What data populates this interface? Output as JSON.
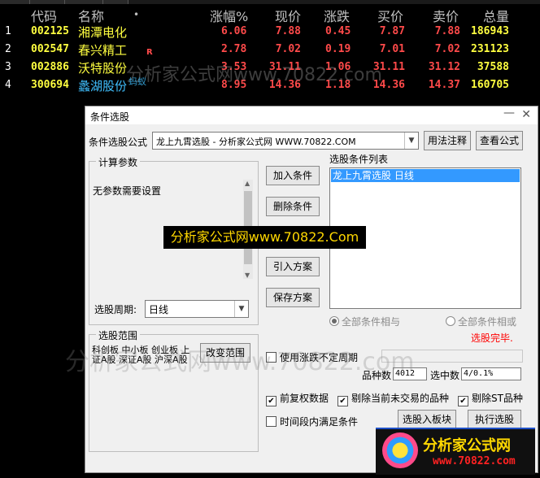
{
  "table": {
    "headers": {
      "code": "代码",
      "name": "名称",
      "dot": "•",
      "change_pct": "涨幅%",
      "price": "现价",
      "change": "涨跌",
      "bid": "买价",
      "ask": "卖价",
      "volume": "总量"
    },
    "rows": [
      {
        "idx": "1",
        "code": "002125",
        "name": "湘潭电化",
        "mark": "",
        "change_pct": "6.06",
        "price": "7.88",
        "change": "0.45",
        "bid": "7.87",
        "ask": "7.88",
        "volume": "186943"
      },
      {
        "idx": "2",
        "code": "002547",
        "name": "春兴精工",
        "mark": "R",
        "change_pct": "2.78",
        "price": "7.02",
        "change": "0.19",
        "bid": "7.01",
        "ask": "7.02",
        "volume": "231123"
      },
      {
        "idx": "3",
        "code": "002886",
        "name": "沃特股份",
        "mark": "",
        "change_pct": "3.53",
        "price": "31.11",
        "change": "1.06",
        "bid": "31.11",
        "ask": "31.12",
        "volume": "37588"
      },
      {
        "idx": "4",
        "code": "300694",
        "name": "蠡湖股份",
        "mark": "",
        "change_pct": "8.95",
        "price": "14.36",
        "change": "1.18",
        "bid": "14.36",
        "ask": "14.37",
        "volume": "160705"
      }
    ]
  },
  "watermarks": {
    "w1": "分析家公式网www.70822.com",
    "w2": "蚂蚁",
    "w3": "分析家公式网www.70822.com"
  },
  "dialog": {
    "title": "条件选股",
    "formula_label": "条件选股公式",
    "formula_value": "龙上九霄选股 - 分析家公式网 WWW.70822.COM",
    "btn_usage": "用法注释",
    "btn_view": "查看公式",
    "params_group": "计算参数",
    "params_text": "无参数需要设置",
    "btn_add": "加入条件",
    "btn_delete": "删除条件",
    "btn_import": "引入方案",
    "btn_save": "保存方案",
    "list_label": "选股条件列表",
    "list_items": [
      "龙上九霄选股  日线"
    ],
    "period_label": "选股周期:",
    "period_value": "日线",
    "radio_and": "全部条件相与",
    "radio_or": "全部条件相或",
    "status": "选股完毕.",
    "range_group": "选股范围",
    "range_text": "科创板 中小板 创业板 上证A股 深证A股 沪深A股",
    "btn_change_range": "改变范围",
    "chk_uncertain": "使用涨跌不定周期",
    "count_label": "品种数",
    "count_value": "4012",
    "selected_label": "选中数",
    "selected_value": "4/0.1%",
    "chk_prefq": "前复权数据",
    "chk_exclude_nontrade": "剔除当前未交易的品种",
    "chk_exclude_st": "剔除ST品种",
    "chk_time_range": "时间段内满足条件",
    "btn_to_block": "选股入板块",
    "btn_execute": "执行选股"
  },
  "banner": "分析家公式网www.70822.Com",
  "logo": {
    "line1": "分析家公式网",
    "line2": "www.70822.com"
  },
  "colors": {
    "up": "#ff4a4a",
    "code": "#ffff40",
    "cyan": "#40c0ff",
    "selection": "#3399ff",
    "status": "#ff0000"
  }
}
